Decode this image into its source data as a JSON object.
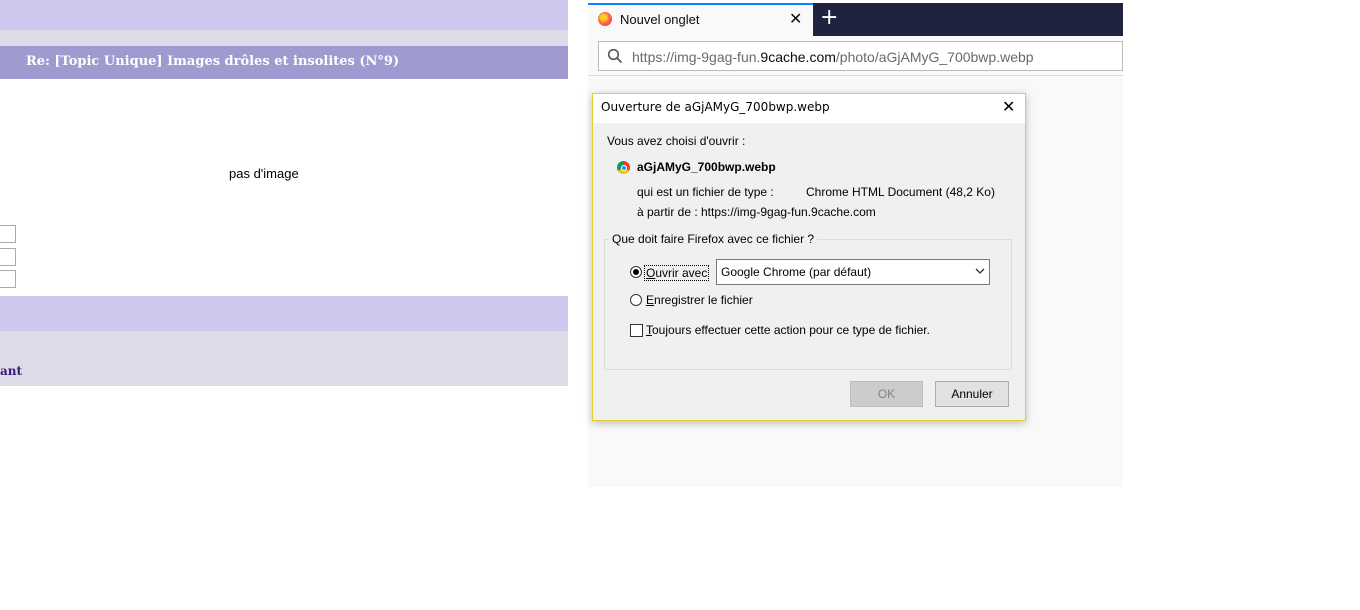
{
  "forum": {
    "topic_title": "Re: [Topic Unique] Images drôles et insolites (N°9)",
    "no_image_text": "pas d'image",
    "truncated_link": "ant"
  },
  "browser": {
    "tab_title": "Nouvel onglet",
    "tab_close": "✕",
    "new_tab": "+",
    "url_prefix": "https://img-9gag-fun.",
    "url_domain": "9cache.com",
    "url_path": "/photo/aGjAMyG_700bwp.webp",
    "icons": {
      "tab": "firefox-icon",
      "search": "search-icon"
    }
  },
  "dialog": {
    "title": "Ouverture de aGjAMyG_700bwp.webp",
    "close": "✕",
    "intro": "Vous avez choisi d'ouvrir :",
    "filename": "aGjAMyG_700bwp.webp",
    "type_label": "qui est un fichier de type :",
    "type_value": "Chrome HTML Document (48,2 Ko)",
    "from_label": "à partir de :",
    "from_value": "https://img-9gag-fun.9cache.com",
    "question": "Que doit faire Firefox avec ce fichier ?",
    "open_with_first": "O",
    "open_with_rest": "uvrir avec",
    "open_with_selected": true,
    "open_with_app": "Google Chrome (par défaut)",
    "save_first": "E",
    "save_rest": "nregistrer le fichier",
    "save_selected": false,
    "always_first": "T",
    "always_rest": "oujours effectuer cette action pour ce type de fichier.",
    "always_checked": false,
    "ok_label": "OK",
    "ok_enabled": false,
    "cancel_label": "Annuler"
  }
}
